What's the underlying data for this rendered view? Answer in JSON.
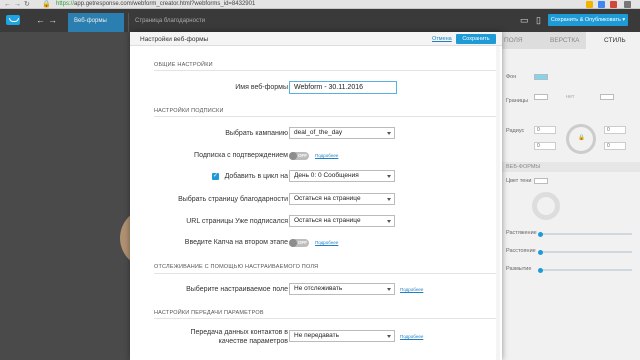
{
  "browser": {
    "url_secure": "https://",
    "url_rest": "app.getresponse.com/webform_creator.html?webforms_id=8432901",
    "back": "←",
    "forward": "→",
    "reload": "↻"
  },
  "app": {
    "tab_active": "Веб-формы",
    "tab_second": "Страница благодарности",
    "publish_button": "Сохранить & Опубликовать ▾",
    "brand_color": "#1e9ad6"
  },
  "right_panel": {
    "tabs": [
      "ПОЛЯ",
      "ВЕРСТКА",
      "СТИЛЬ"
    ],
    "rows": [
      "Фон",
      "Границы",
      "Радиус"
    ],
    "section_webform": "ВЕБ-ФОРМЫ",
    "section_rows": [
      "Цвет тени",
      "Растяжение",
      "Расстояние",
      "Размытие"
    ],
    "values": [
      "0",
      "0",
      "0",
      "0",
      "0",
      "0",
      "0"
    ],
    "none_option": "нет"
  },
  "modal": {
    "title": "Настройки веб-формы",
    "cancel": "Отмена",
    "save": "Сохранить",
    "section_general": "ОБЩИЕ НАСТРОЙКИ",
    "section_subscription": "НАСТРОЙКИ ПОДПИСКИ",
    "section_tracking": "ОТСЛЕЖИВАНИЕ С ПОМОЩЬЮ НАСТРАИВАЕМОГО ПОЛЯ",
    "section_params": "НАСТРОЙКИ ПЕРЕДАЧИ ПАРАМЕТРОВ",
    "webform_name_label": "Имя веб-формы",
    "webform_name_value": "Webform - 30.11.2016",
    "campaign_label": "Выбрать кампанию",
    "campaign_value": "deal_of_the_day",
    "double_optin_label": "Подписка с подтверждением",
    "double_optin_state": "OFF",
    "more_link": "Подробнее",
    "cycle_label": "Добавить в цикл на",
    "cycle_value": "День 0: 0 Сообщения",
    "thankyou_label": "Выбрать страницу благодарности",
    "thankyou_value": "Остаться на странице",
    "already_label": "URL страницы Уже подписался",
    "already_value": "Остаться на странице",
    "captcha_label": "Введите Капча на втором этапе",
    "captcha_state": "OFF",
    "custom_field_label": "Выберите настраиваемое поле",
    "custom_field_value": "Не отслеживать",
    "pass_label_1": "Передача данных контактов в",
    "pass_label_2": "качестве параметров",
    "pass_value": "Не передавать"
  }
}
